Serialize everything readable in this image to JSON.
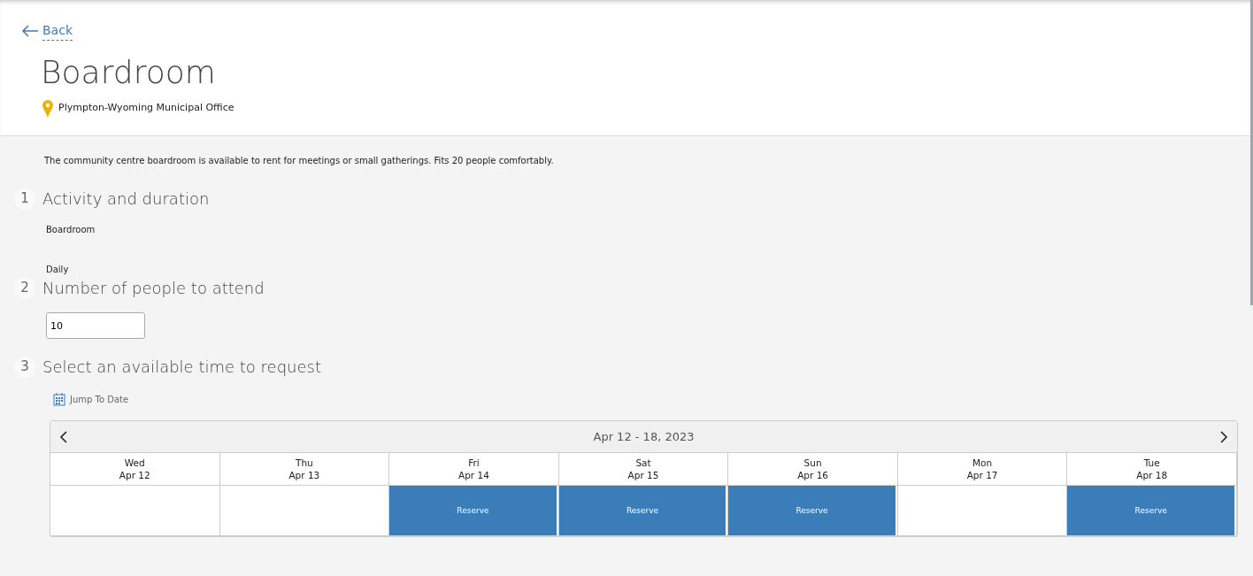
{
  "back_link": "Back",
  "title": "Boardroom",
  "location": "Plympton-Wyoming Municipal Office",
  "description": "The community centre boardroom is available to rent for meetings or small gatherings. Fits 20 people comfortably.",
  "steps": [
    {
      "number": "1",
      "title": "Activity and duration",
      "kind": "text",
      "lines": [
        "Boardroom",
        "Daily"
      ]
    },
    {
      "number": "2",
      "title": "Number of people to attend",
      "kind": "number",
      "value": "10"
    },
    {
      "number": "3",
      "title": "Select an available time to request",
      "kind": "calendar"
    }
  ],
  "jump_to_date": "Jump To Date",
  "calendar": {
    "range": "Apr 12 - 18, 2023",
    "days": [
      {
        "weekday": "Wed",
        "date": "Apr 12",
        "available": false
      },
      {
        "weekday": "Thu",
        "date": "Apr 13",
        "available": false
      },
      {
        "weekday": "Fri",
        "date": "Apr 14",
        "available": true,
        "action": "Reserve"
      },
      {
        "weekday": "Sat",
        "date": "Apr 15",
        "available": true,
        "action": "Reserve"
      },
      {
        "weekday": "Sun",
        "date": "Apr 16",
        "available": true,
        "action": "Reserve"
      },
      {
        "weekday": "Mon",
        "date": "Apr 17",
        "available": false
      },
      {
        "weekday": "Tue",
        "date": "Apr 18",
        "available": true,
        "action": "Reserve"
      }
    ]
  }
}
